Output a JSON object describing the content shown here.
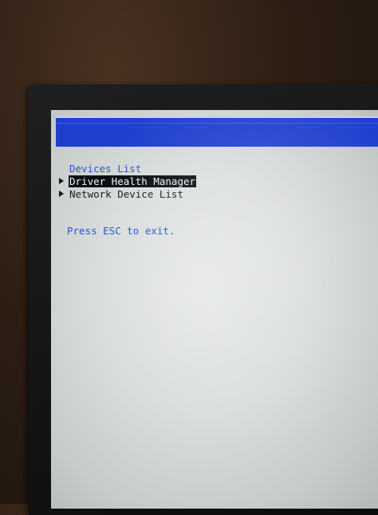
{
  "menu": {
    "title": "Devices List",
    "items": [
      {
        "label": "Driver Health Manager",
        "selected": true
      },
      {
        "label": "Network Device List",
        "selected": false
      }
    ]
  },
  "hint": "Press ESC to exit.",
  "colors": {
    "title_bar": "#1f3fcf",
    "text_blue": "#2b52d6",
    "screen_bg": "#d9dddc",
    "selection_bg": "#0c0d10"
  }
}
